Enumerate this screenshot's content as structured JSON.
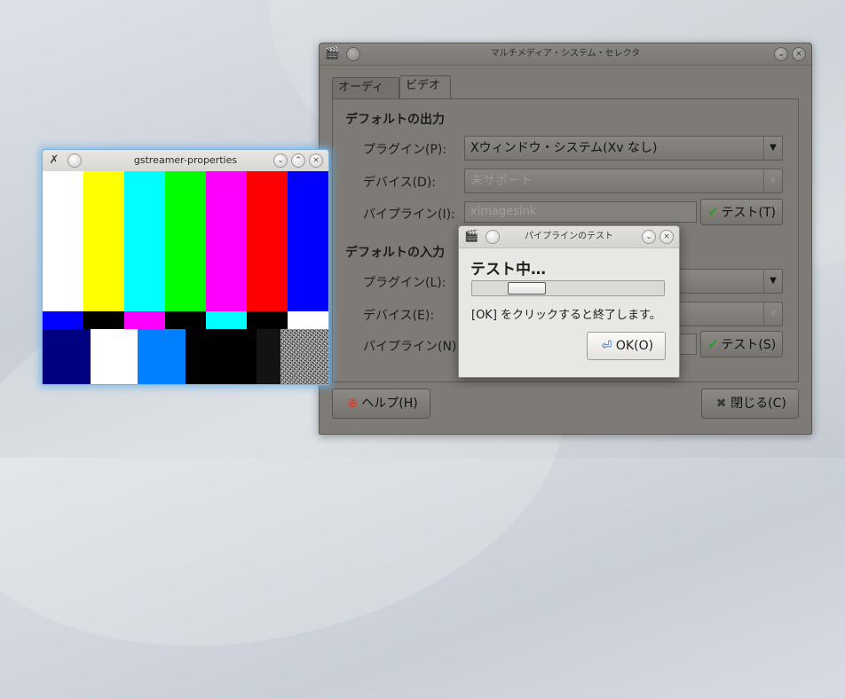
{
  "main_window": {
    "title": "マルチメディア・システム・セレクタ",
    "tabs": [
      {
        "label": "オーディオ",
        "active": false
      },
      {
        "label": "ビデオ",
        "active": true
      }
    ],
    "output_section": {
      "title": "デフォルトの出力",
      "plugin_label": "プラグイン(P):",
      "plugin_value": "Xウィンドウ・システム(Xv なし)",
      "device_label": "デバイス(D):",
      "device_value": "未サポート",
      "pipeline_label": "パイプライン(I):",
      "pipeline_value": "ximagesink",
      "test_button": "テスト(T)"
    },
    "input_section": {
      "title": "デフォルトの入力",
      "plugin_label": "プラグイン(L):",
      "device_label": "デバイス(E):",
      "pipeline_label": "パイプライン(N):",
      "test_button": "テスト(S)"
    },
    "help_button": "ヘルプ(H)",
    "close_button": "閉じる(C)"
  },
  "dialog": {
    "title": "パイプラインのテスト",
    "heading": "テスト中…",
    "message": "[OK] をクリックすると終了します。",
    "ok_button": "OK(O)"
  },
  "gst_window": {
    "title": "gstreamer-properties",
    "top_bars": [
      "#ffffff",
      "#ffff00",
      "#00ffff",
      "#00ff00",
      "#ff00ff",
      "#ff0000",
      "#0000ff"
    ],
    "mid_bars": [
      "#0000ff",
      "#000000",
      "#ff00ff",
      "#000000",
      "#00ffff",
      "#000000",
      "#ffffff"
    ],
    "bottom_bars": [
      "#000080",
      "#ffffff",
      "#0080ff",
      "#000000",
      "#000000",
      "#131313"
    ]
  },
  "icons": {
    "app_icon": "applications-multimedia-icon",
    "help_icon": "lifebuoy-icon",
    "close_icon": "close-x-icon",
    "check_icon": "check-icon",
    "ok_icon": "enter-arrow-icon"
  }
}
